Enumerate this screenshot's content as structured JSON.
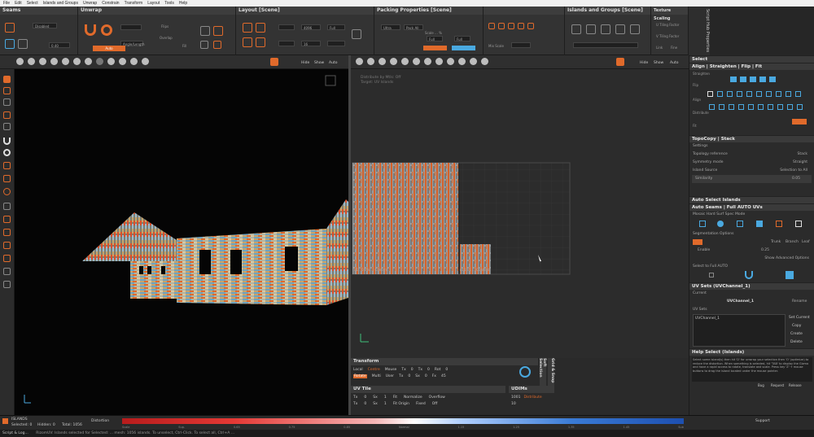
{
  "menu": [
    "File",
    "Edit",
    "Select",
    "Islands and Groups",
    "Unwrap",
    "Constrain",
    "Transform",
    "Layout",
    "Tools",
    "Help"
  ],
  "toolbar": {
    "seams": {
      "title": "Seams",
      "mode_label": "Disabled",
      "value": "0.40"
    },
    "unwrap": {
      "title": "Unwrap",
      "mode": "Angle/Length",
      "flip_label": "Flips",
      "overlap_label": "Overlap",
      "fill_label": "Fill",
      "button": "Auto"
    },
    "layout": {
      "title": "Layout [Scene]",
      "margin": "4096",
      "padding": "16",
      "rescale": "Full"
    },
    "packing": {
      "title": "Packing Properties [Scene]",
      "quality": "Ultra",
      "pack_all": "Pack All",
      "full_left": "Full",
      "full_right": "Full",
      "scale_label": "Scale ... %"
    },
    "islands": {
      "title": "Islands and Groups [Scene]"
    },
    "texture": {
      "title": "Texture Scaling",
      "u_tiling": "U Tiling Factor",
      "v_tiling": "V Tiling Factor",
      "link": "Link",
      "fine": "Fine"
    },
    "mix_scale": "Mix Scale"
  },
  "script_hub": "Script Hub Properties",
  "ribbon3d": {
    "labels": [
      "Hide",
      "Show",
      "Auto"
    ]
  },
  "ribbonuv": {
    "labels": [
      "Hide",
      "Show",
      "Auto"
    ]
  },
  "uv_viewport": {
    "info_line1": "Distribute by Mtls: Off",
    "info_line2": "Target: UV Islands",
    "bottom_label_left": "u1 : 0.0% ... Content",
    "bottom_label_right": "u11 v1 ... Content"
  },
  "transform_panel": {
    "title": "Transform",
    "row1": [
      "Local",
      "Centre",
      "Mouse",
      "Tx",
      "0",
      "Tx",
      "0",
      "Rot",
      "0"
    ],
    "row2": [
      "Rotate",
      "Multi",
      "User",
      "Tx",
      "0",
      "Sx",
      "0",
      "Fx",
      "45"
    ]
  },
  "uvtile_panel": {
    "title": "UV Tile",
    "row1": [
      "Tx",
      "0",
      "Sx",
      "1",
      "Fit",
      "Normalize",
      "Overflow"
    ],
    "row2": [
      "Tx",
      "0",
      "Sx",
      "1",
      "Fit Origin",
      "Fixed",
      "Off"
    ]
  },
  "udims_panel": {
    "title": "UDIMs",
    "value": "1001",
    "btn": "Distribute",
    "count": "10"
  },
  "vertical_tabs": {
    "tab1": "Grid & Snap",
    "tab2": "Soft Selection"
  },
  "right": {
    "select": "Select",
    "align": "Align | Straighten | Flip | Fit",
    "align_sections": [
      "Straighten",
      "Flip",
      "Align",
      "Distribute",
      "Fit"
    ],
    "topocopy": "TopoCopy | Stack",
    "topo_rows": [
      {
        "label": "Settings",
        "value": ""
      },
      {
        "label": "Topology reference",
        "value": "Stack"
      },
      {
        "label": "Symmetry mode",
        "value": "Straight"
      },
      {
        "label": "Island Source",
        "value": "Selection to All"
      },
      {
        "label": "Similarity",
        "value": "0.05"
      }
    ],
    "auto_select": "Auto Select Islands",
    "auto_seams": "Auto Seams | Full AUTO UVs",
    "auto_seams_rows": [
      "Mosaic Hard Surf Spec Mode",
      "Segmentation Options"
    ],
    "auto_seams_buttons": [
      "Trunk",
      "Branch",
      "Leaf"
    ],
    "auto_enable": "Enable",
    "auto_value": "0.25",
    "advanced": "Show Advanced Options",
    "full_auto": "Select to Full AUTO",
    "uv_sets": "UV Sets (UVChannel_1)",
    "current_label": "Current",
    "current_channel": "UVChannel_1",
    "rename": "Rename",
    "uv_list_label": "UV Sets",
    "uv_list": [
      "UVChannel_1"
    ],
    "uv_buttons": [
      "Set Current",
      "Copy",
      "Create",
      "Delete"
    ],
    "help": "Help Select (Islands)",
    "help_text": "Select some island(s) then hit 'D' for unwrap your selection then 'O' (optimize) to reduce the distortion. When something is selected, hit 'TAB' to display the Gizmo and have a rapid access to rotate, translate and scale. Press key 'Z' + mouse buttons to drag the island located under the mouse pointer.",
    "footer": [
      "Bug",
      "Request",
      "Release"
    ]
  },
  "status": {
    "islands_label": "ISLANDS",
    "selected": "Selected: 0",
    "hidden": "Hidden: 0",
    "total": "Total: 1056",
    "distortion": "Distortion",
    "ticks": [
      "Scale",
      "Sup.",
      "0.65",
      "0.75",
      "0.85",
      "Normal",
      "1.15",
      "1.25",
      "1.35",
      "1.45",
      "Sub"
    ],
    "support": "Support"
  },
  "footer": {
    "script": "Script & Log...",
    "message": "RizomUV: Islands selected for Selected: ... mesh: 1056 islands. To unselect, Ctrl-Click. To select all, Ctrl+A ..."
  }
}
